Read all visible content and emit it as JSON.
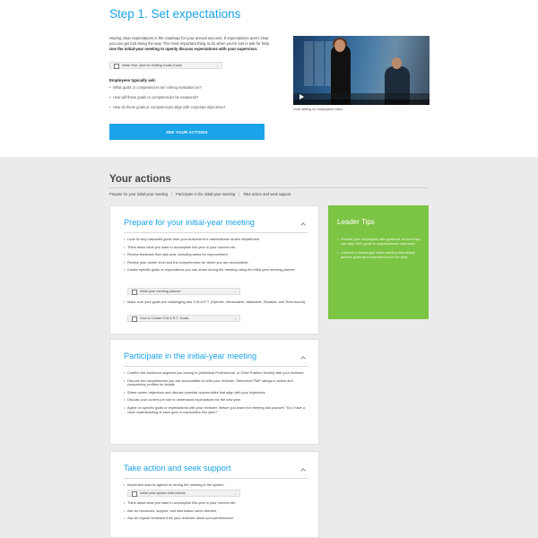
{
  "step": {
    "title": "Step 1. Set expectations",
    "intro_text": "Having clear expectations is the roadmap for your annual success. If expectations aren't clear you can get lost along the way. The most important thing to do when you're lost is ask for help.",
    "intro_bold": "Use the initial-year meeting to openly discuss expectations with your supervisor.",
    "guide_link": "Initial Year Q&A for Setting Goals Guide",
    "ask_title": "Employees typically ask:",
    "ask_items": [
      "What goals or competencies am I being evaluated on?",
      "How will these goals or competencies be measured?",
      "How do these goals or competencies align with corporate objectives?"
    ],
    "cta_label": "SEE YOUR ACTIONS",
    "video_caption": "Goal setting for employees video"
  },
  "actions": {
    "title": "Your actions",
    "crumbs": [
      "Prepare for your initial-year meeting",
      "Participate in the initial-year meeting",
      "Take action and seek support"
    ],
    "crumb_sep": "|"
  },
  "cards": [
    {
      "title": "Prepare for your initial-year meeting",
      "items": [
        "Look for any cascaded goals from your business line administrator and/or department.",
        "Think about what you want to accomplish this year in your current role.",
        "Review feedback from last year, including areas for improvement.",
        "Review your career level and the competencies for which you are accountable.",
        "Create specific goals or expectations you can share during the meeting using the initial year meeting planner.",
        "Make sure your goals are challenging and S.M.A.R.T. (Specific, Measurable, Attainable, Realistic, and Time-bound)."
      ],
      "links": [
        "Initial year meeting planner",
        "How to Create S.M.A.R.T. Goals"
      ]
    },
    {
      "title": "Participate in the initial-year meeting",
      "items": [
        "Confirm the workforce segment you belong to (Individual Professional, or Chief Position Holder) with your reviewer.",
        "Discuss the competencies you are accountable for with your reviewer. Reference PMP ratings in action and competency profiles for details.",
        "Share career objectives and discuss potential opportunities that align with your objectives.",
        "Discuss your current job role to understand expectations for the new year.",
        "Agree on specific goals or expectations with your reviewer. Before you leave the meeting ask yourself, \"Do I have a clear understanding of each goal or expectation this year?\""
      ]
    },
    {
      "title": "Take action and seek support",
      "items": [
        "Implement actions agreed on during the meeting in the system.",
        "Think about what you want to accomplish this year in your current role.",
        "Ask for resources, support, and information when needed.",
        "Ask for regular feedback from your reviewer about your performance."
      ],
      "links": [
        "Initial year system instructions"
      ]
    }
  ],
  "tips": {
    "title": "Leader Tips",
    "items": [
      "Provide your employees with guidance on how they can align their goals to organizational objectives.",
      "Conduct a meaningful initial meeting that clearly defines goals and expectations for the year."
    ]
  }
}
